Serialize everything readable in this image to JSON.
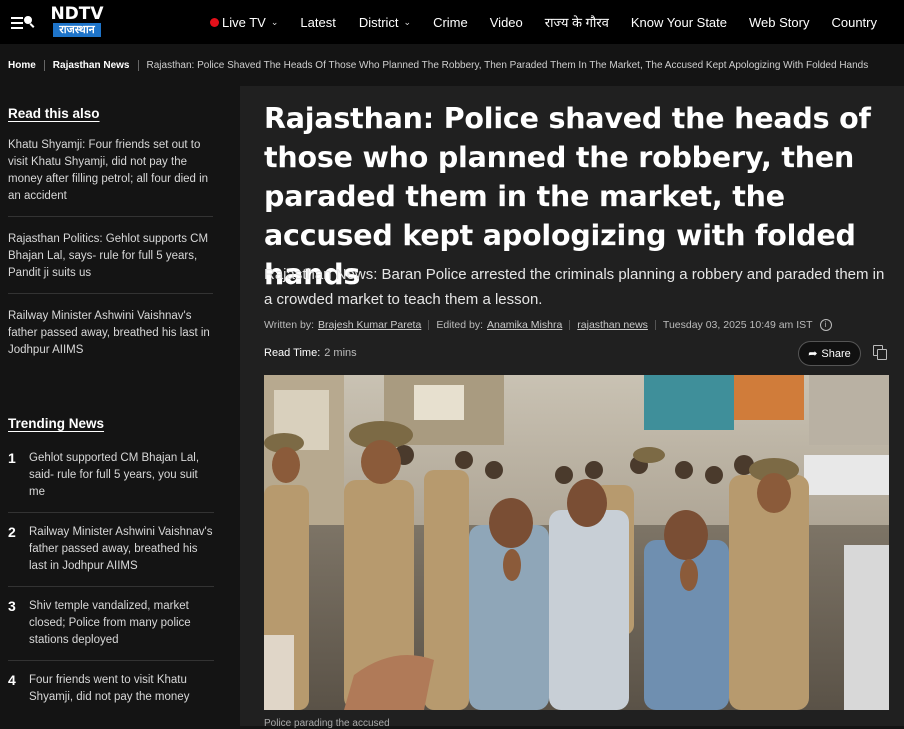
{
  "nav": {
    "logo_text": "NDTV",
    "logo_sub": "राजस्थान",
    "items": [
      {
        "label": "Live TV",
        "live": true,
        "dropdown": true
      },
      {
        "label": "Latest",
        "dropdown": false
      },
      {
        "label": "District",
        "dropdown": true
      },
      {
        "label": "Crime",
        "dropdown": false
      },
      {
        "label": "Video",
        "dropdown": false
      },
      {
        "label": "राज्य के गौरव",
        "dropdown": false
      },
      {
        "label": "Know Your State",
        "dropdown": false
      },
      {
        "label": "Web Story",
        "dropdown": false
      },
      {
        "label": "Country",
        "dropdown": false
      }
    ]
  },
  "breadcrumb": {
    "home": "Home",
    "section": "Rajasthan News",
    "current": "Rajasthan: Police Shaved The Heads Of Those Who Planned The Robbery, Then Paraded Them In The Market, The Accused Kept Apologizing With Folded Hands"
  },
  "sidebar": {
    "read_also_title": "Read this also",
    "read_also": [
      "Khatu Shyamji: Four friends set out to visit Khatu Shyamji, did not pay the money after filling petrol; all four died in an accident",
      "Rajasthan Politics: Gehlot supports CM Bhajan Lal, says- rule for full 5 years, Pandit ji suits us",
      "Railway Minister Ashwini Vaishnav's father passed away, breathed his last in Jodhpur AIIMS"
    ],
    "trending_title": "Trending News",
    "trending": [
      {
        "num": "1",
        "text": "Gehlot supported CM Bhajan Lal, said- rule for full 5 years, you suit me"
      },
      {
        "num": "2",
        "text": "Railway Minister Ashwini Vaishnav's father passed away, breathed his last in Jodhpur AIIMS"
      },
      {
        "num": "3",
        "text": "Shiv temple vandalized, market closed; Police from many police stations deployed"
      },
      {
        "num": "4",
        "text": "Four friends went to visit Khatu Shyamji, did not pay the money"
      }
    ]
  },
  "article": {
    "headline": "Rajasthan: Police shaved the heads of those who planned the robbery, then paraded them in the market, the accused kept apologizing with folded hands",
    "subhead": "Rajasthan News: Baran Police arrested the criminals planning a robbery and paraded them in a crowded market to teach them a lesson.",
    "written_by_label": "Written by:",
    "author": "Brajesh Kumar Pareta",
    "edited_by_label": "Edited by:",
    "editor": "Anamika Mishra",
    "category": "rajasthan news",
    "date": "Tuesday 03, 2025 10:49 am IST",
    "read_time_label": "Read Time:",
    "read_time": "2 mins",
    "share_label": "Share",
    "caption": "Police parading the accused"
  },
  "colors": {
    "live_dot": "#e3101a",
    "logo_sub_bg": "#1e74c9",
    "page_bg": "#141414",
    "article_bg": "#202020"
  }
}
